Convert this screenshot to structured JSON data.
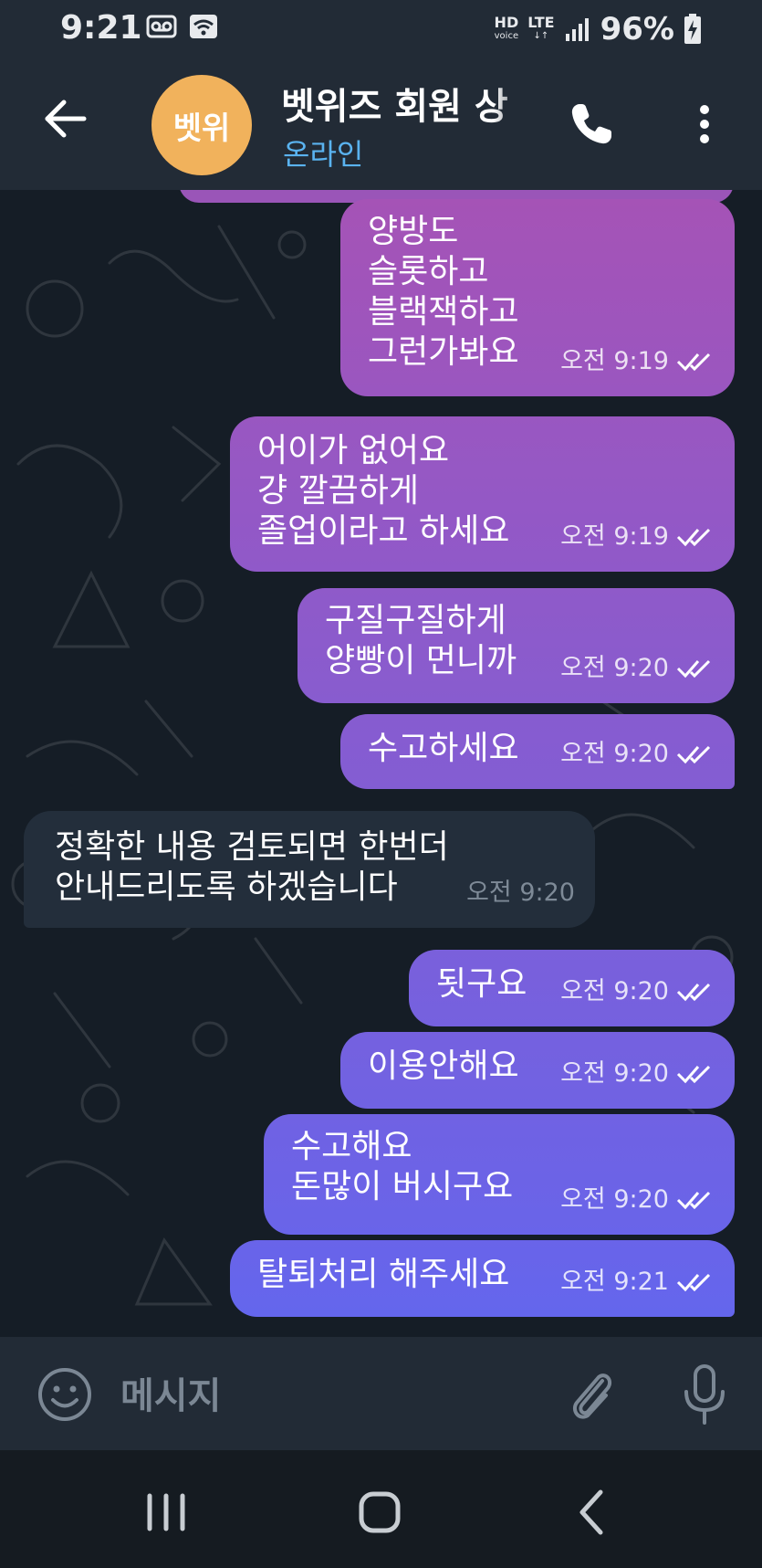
{
  "status": {
    "time": "9:21",
    "network": "HD",
    "network_sub": "voice",
    "lte": "LTE",
    "battery": "96%"
  },
  "header": {
    "avatar_text": "벳위",
    "title": "벳위즈 회원 상",
    "subtitle": "온라인"
  },
  "messages": [
    {
      "text": "양방도\n슬롯하고\n블랙잭하고\n그런가봐요",
      "time": "오전 9:19",
      "out": true
    },
    {
      "text": "어이가 없어요\n걍 깔끔하게\n졸업이라고 하세요",
      "time": "오전 9:19",
      "out": true
    },
    {
      "text": "구질구질하게\n양빵이 먼니까",
      "time": "오전 9:20",
      "out": true
    },
    {
      "text": "수고하세요",
      "time": "오전 9:20",
      "out": true
    },
    {
      "text": "정확한 내용 검토되면 한번더\n안내드리도록 하겠습니다",
      "time": "오전 9:20",
      "out": false
    },
    {
      "text": "됫구요",
      "time": "오전 9:20",
      "out": true
    },
    {
      "text": "이용안해요",
      "time": "오전 9:20",
      "out": true
    },
    {
      "text": "수고해요\n돈많이 버시구요",
      "time": "오전 9:20",
      "out": true
    },
    {
      "text": "탈퇴처리 해주세요",
      "time": "오전 9:21",
      "out": true
    }
  ],
  "input": {
    "placeholder": "메시지"
  },
  "colors": {
    "bubble_top": "#a653b6",
    "bubble_bottom": "#6366ee",
    "incoming_bubble": "#232e3b",
    "accent": "#5ab3f0",
    "avatar": "#f1b25c"
  }
}
